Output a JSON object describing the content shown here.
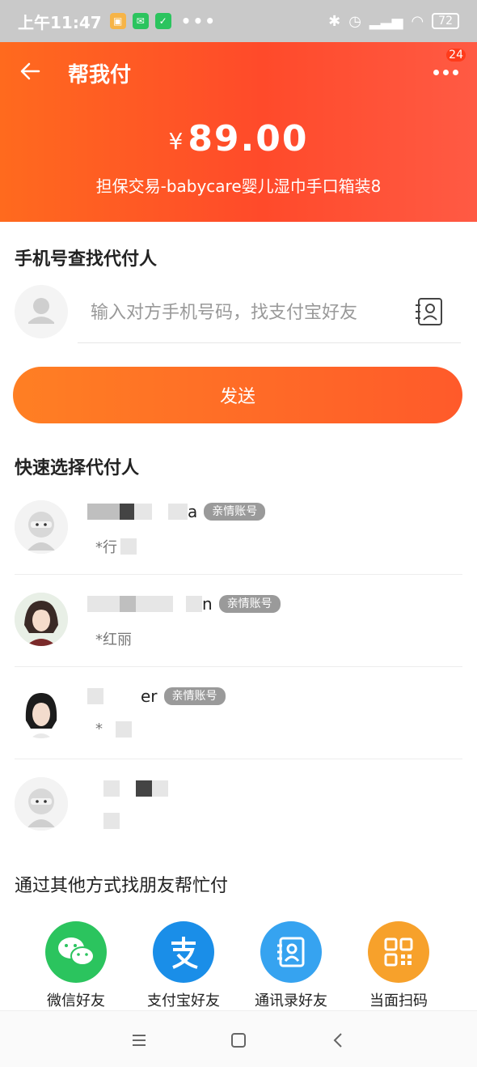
{
  "status_bar": {
    "time": "上午11:47",
    "dots": "•••",
    "battery": "72"
  },
  "header": {
    "title": "帮我付",
    "badge": "24",
    "currency": "¥",
    "amount": "89.00",
    "description": "担保交易-babycare婴儿湿巾手口箱装8"
  },
  "phone_search": {
    "title": "手机号查找代付人",
    "placeholder": "输入对方手机号码，找支付宝好友"
  },
  "send_button": "发送",
  "quick_select": {
    "title": "快速选择代付人",
    "payers": [
      {
        "name_suffix": "a",
        "tag": "亲情账号",
        "sub": "*行",
        "avatar": "ninja"
      },
      {
        "name_suffix": "n",
        "tag": "亲情账号",
        "sub": "*红丽",
        "avatar": "anime"
      },
      {
        "name_suffix": "er",
        "tag": "亲情账号",
        "sub": "*",
        "avatar": "girl"
      },
      {
        "name_suffix": "",
        "tag": "",
        "sub": "",
        "avatar": "ninja"
      }
    ]
  },
  "other_ways": {
    "title": "通过其他方式找朋友帮忙付",
    "items": [
      {
        "label": "微信好友",
        "icon": "wechat-icon",
        "color": "#2bc45e"
      },
      {
        "label": "支付宝好友",
        "icon": "alipay-icon",
        "color": "#1a8ee8"
      },
      {
        "label": "通讯录好友",
        "icon": "contacts-icon",
        "color": "#36a3f0"
      },
      {
        "label": "当面扫码",
        "icon": "qrcode-icon",
        "color": "#f7a12b"
      }
    ]
  }
}
